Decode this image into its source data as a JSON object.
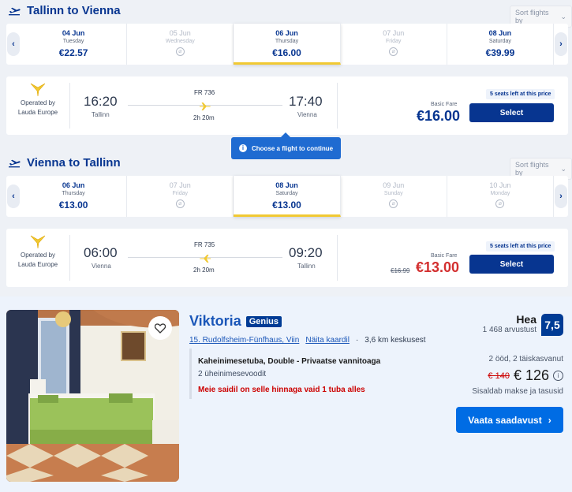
{
  "outbound": {
    "title": "Tallinn to Vienna",
    "sort_label": "Sort flights by",
    "dates": [
      {
        "date": "04 Jun",
        "weekday": "Tuesday",
        "price": "€22.57",
        "available": true
      },
      {
        "date": "05 Jun",
        "weekday": "Wednesday",
        "price": "",
        "available": false
      },
      {
        "date": "06 Jun",
        "weekday": "Thursday",
        "price": "€16.00",
        "available": true,
        "selected": true
      },
      {
        "date": "07 Jun",
        "weekday": "Friday",
        "price": "",
        "available": false
      },
      {
        "date": "08 Jun",
        "weekday": "Saturday",
        "price": "€39.99",
        "available": true
      }
    ],
    "flight": {
      "operated_by": "Operated by",
      "operator": "Lauda Europe",
      "depart_time": "16:20",
      "depart_city": "Tallinn",
      "flight_no": "FR 736",
      "duration": "2h 20m",
      "arrive_time": "17:40",
      "arrive_city": "Vienna",
      "fare_label": "Basic Fare",
      "seats_left": "5 seats left at this price",
      "price": "€16.00",
      "select_label": "Select"
    }
  },
  "tooltip": {
    "text": "Choose a flight to continue"
  },
  "inbound": {
    "title": "Vienna to Tallinn",
    "sort_label": "Sort flights by",
    "dates": [
      {
        "date": "06 Jun",
        "weekday": "Thursday",
        "price": "€13.00",
        "available": true
      },
      {
        "date": "07 Jun",
        "weekday": "Friday",
        "price": "",
        "available": false
      },
      {
        "date": "08 Jun",
        "weekday": "Saturday",
        "price": "€13.00",
        "available": true,
        "selected": true
      },
      {
        "date": "09 Jun",
        "weekday": "Sunday",
        "price": "",
        "available": false
      },
      {
        "date": "10 Jun",
        "weekday": "Monday",
        "price": "",
        "available": false
      }
    ],
    "flight": {
      "operated_by": "Operated by",
      "operator": "Lauda Europe",
      "depart_time": "06:00",
      "depart_city": "Vienna",
      "flight_no": "FR 735",
      "duration": "2h 20m",
      "arrive_time": "09:20",
      "arrive_city": "Tallinn",
      "fare_label": "Basic Fare",
      "seats_left": "5 seats left at this price",
      "old_price": "€16.99",
      "price": "€13.00",
      "select_label": "Select"
    }
  },
  "hotel": {
    "name": "Viktoria",
    "badge": "Genius",
    "district": "15. Rudolfsheim-Fünfhaus, Viin",
    "map_link": "Näita kaardil",
    "distance": "3,6 km keskusest",
    "room_title": "Kaheinimesetuba, Double - Privaatse vannitoaga",
    "beds": "2 üheinimesevoodit",
    "urgency": "Meie saidil on selle hinnaga vaid 1 tuba alles",
    "score_word": "Hea",
    "reviews": "1 468 arvustust",
    "score": "7,5",
    "stay": "2 ööd, 2 täiskasvanut",
    "old_price": "€ 140",
    "price": "€ 126",
    "taxes": "Sisaldab makse ja tasusid",
    "cta": "Vaata saadavust"
  },
  "colors": {
    "brand": "#073590",
    "accent": "#f1c933",
    "cta": "#006ce4",
    "alert": "#cc0000"
  }
}
